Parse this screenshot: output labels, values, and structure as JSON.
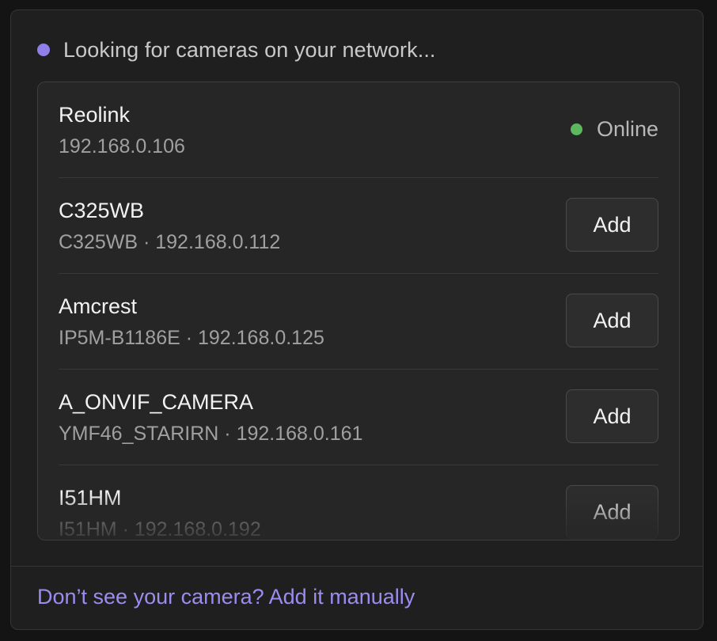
{
  "status": {
    "text": "Looking for cameras on your network...",
    "dot_color": "#8f7fe8"
  },
  "cameras": [
    {
      "name": "Reolink",
      "detail": "192.168.0.106",
      "state": "Online",
      "state_color": "#5cb85c"
    },
    {
      "name": "C325WB",
      "detail": "C325WB · 192.168.0.112",
      "action": "Add"
    },
    {
      "name": "Amcrest",
      "detail": "IP5M-B1186E · 192.168.0.125",
      "action": "Add"
    },
    {
      "name": "A_ONVIF_CAMERA",
      "detail": "YMF46_STARIRN · 192.168.0.161",
      "action": "Add"
    },
    {
      "name": "I51HM",
      "detail": "I51HM · 192.168.0.192",
      "action": "Add"
    }
  ],
  "footer": {
    "manual_link": "Don’t see your camera? Add it manually",
    "link_color": "#9d8cef"
  }
}
